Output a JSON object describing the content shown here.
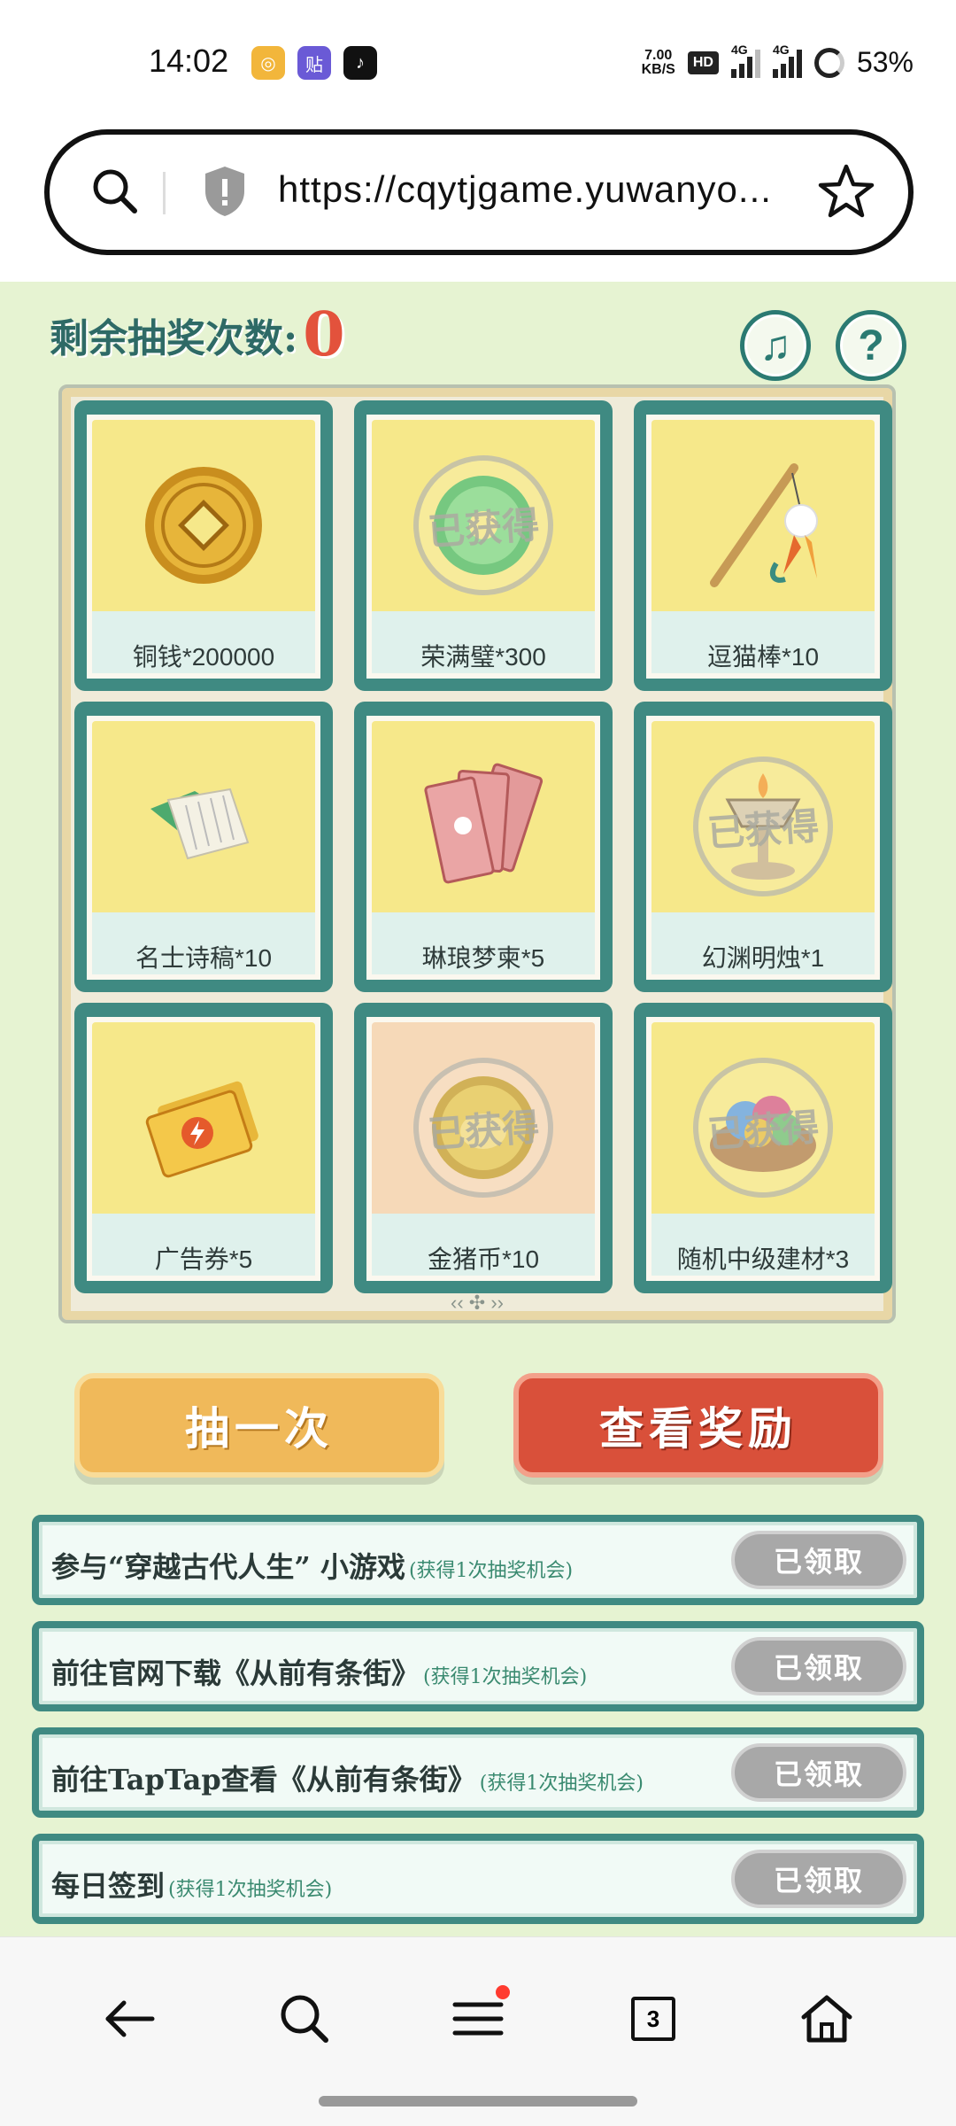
{
  "status_bar": {
    "time": "14:02",
    "net_speed_value": "7.00",
    "net_speed_unit": "KB/S",
    "hd_badge": "HD",
    "sim1_tag": "4G",
    "sim2_tag": "4G",
    "battery": "53%"
  },
  "browser": {
    "url": "https://cqytjgame.yuwanyo..."
  },
  "game": {
    "remaining_label": "剩余抽奖次数:",
    "remaining_count": "0",
    "prizes": [
      {
        "label": "铜钱*200000",
        "obtained": false,
        "icon": "copper-coin"
      },
      {
        "label": "荣满璧*300",
        "obtained": true,
        "icon": "jade-disc"
      },
      {
        "label": "逗猫棒*10",
        "obtained": false,
        "icon": "cat-teaser"
      },
      {
        "label": "名士诗稿*10",
        "obtained": false,
        "icon": "poem-scroll"
      },
      {
        "label": "琳琅梦柬*5",
        "obtained": false,
        "icon": "dream-letters"
      },
      {
        "label": "幻渊明烛*1",
        "obtained": true,
        "icon": "candle"
      },
      {
        "label": "广告券*5",
        "obtained": false,
        "icon": "ad-ticket"
      },
      {
        "label": "金猪币*10",
        "obtained": true,
        "icon": "gold-pig-coin"
      },
      {
        "label": "随机中级建材*3",
        "obtained": true,
        "icon": "building-materials"
      }
    ],
    "obtained_stamp": "已获得",
    "draw_button": "抽一次",
    "view_rewards_button": "查看奖励",
    "tasks": [
      {
        "title": "参与“穿越古代人生” 小游戏",
        "note": "(获得1次抽奖机会)",
        "button": "已领取"
      },
      {
        "title": "前往官网下载《从前有条街》",
        "note": "(获得1次抽奖机会)",
        "button": "已领取"
      },
      {
        "title": "前往TapTap查看《从前有条街》",
        "note": "(获得1次抽奖机会)",
        "button": "已领取"
      },
      {
        "title": "每日签到",
        "note": "(获得1次抽奖机会)",
        "button": "已领取"
      }
    ]
  },
  "bottom_nav": {
    "tab_count": "3"
  }
}
